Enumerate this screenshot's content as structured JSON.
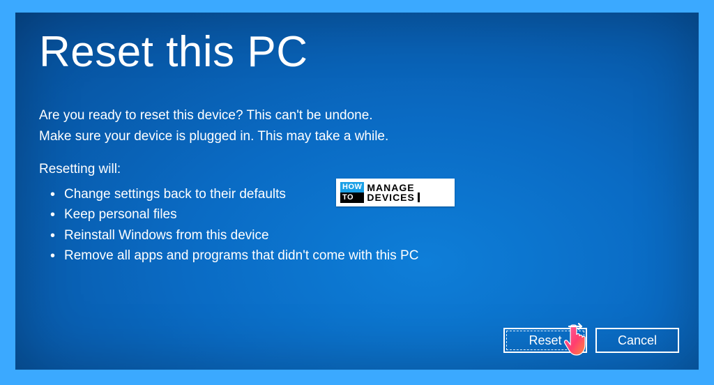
{
  "title": "Reset this PC",
  "intro_line1": "Are you ready to reset this device? This can't be undone.",
  "intro_line2": "Make sure your device is plugged in. This may take a while.",
  "subhead": "Resetting will:",
  "bullets": [
    "Change settings back to their defaults",
    "Keep personal files",
    "Reinstall Windows from this device",
    "Remove all apps and programs that didn't come with this PC"
  ],
  "buttons": {
    "reset": "Reset",
    "cancel": "Cancel"
  },
  "watermark": {
    "tile_top": "HOW",
    "tile_bottom": "TO",
    "word1": "MANAGE",
    "word2": "DEVICES"
  }
}
